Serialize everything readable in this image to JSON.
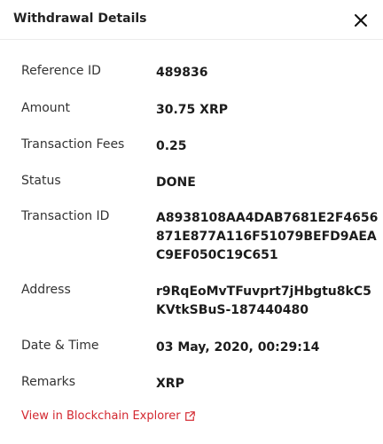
{
  "dialog": {
    "title": "Withdrawal Details",
    "close_icon": "close-icon"
  },
  "details": {
    "reference_id": {
      "label": "Reference ID",
      "value": "489836"
    },
    "amount": {
      "label": "Amount",
      "value": "30.75 XRP"
    },
    "fees": {
      "label": "Transaction Fees",
      "value": "0.25"
    },
    "status": {
      "label": "Status",
      "value": "DONE"
    },
    "transaction_id": {
      "label": "Transaction ID",
      "lines": [
        "A8938108AA4DAB7681E2F4656",
        "871E877A116F51079BEFD9AEA",
        "C9EF050C19C651"
      ]
    },
    "address": {
      "label": "Address",
      "lines": [
        "r9RqEoMvTFuvprt7jHbgtu8kC5",
        "KVtkSBuS-187440480"
      ]
    },
    "datetime": {
      "label": "Date & Time",
      "value": "03 May, 2020, 00:29:14"
    },
    "remarks": {
      "label": "Remarks",
      "value": "XRP"
    }
  },
  "explorer_link": {
    "label": "View in Blockchain Explorer",
    "icon": "external-link-icon",
    "color": "#d3272f"
  }
}
